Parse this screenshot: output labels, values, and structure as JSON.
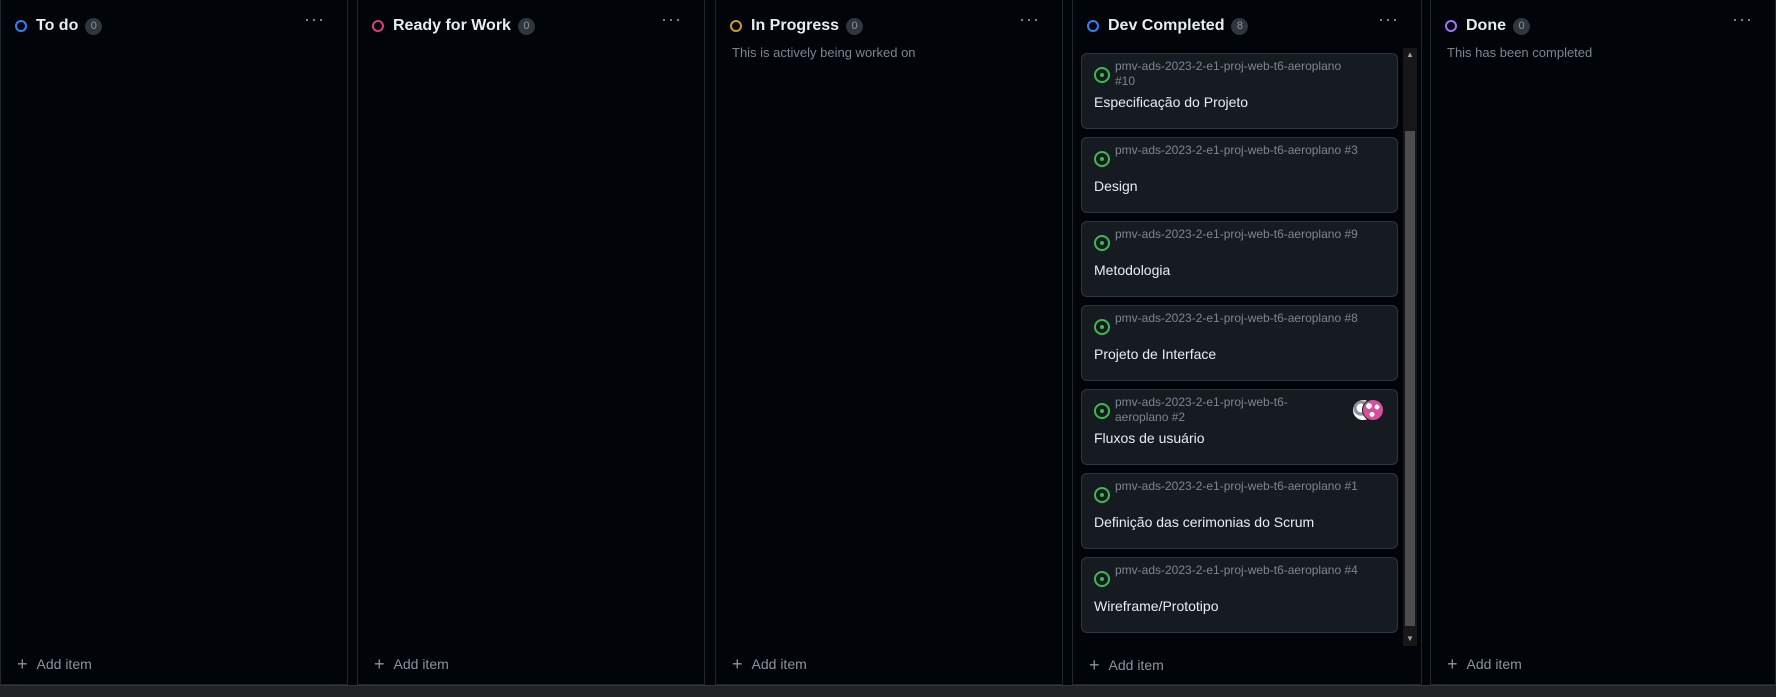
{
  "columns": [
    {
      "title": "To do",
      "count": "0",
      "color": "#2f81f7",
      "description": "",
      "add_label": "Add item"
    },
    {
      "title": "Ready for Work",
      "count": "0",
      "color": "#db3c80",
      "description": "",
      "add_label": "Add item"
    },
    {
      "title": "In Progress",
      "count": "0",
      "color": "#d29922",
      "description": "This is actively being worked on",
      "add_label": "Add item"
    },
    {
      "title": "Dev Completed",
      "count": "8",
      "color": "#2f81f7",
      "description": "",
      "add_label": "Add item"
    },
    {
      "title": "Done",
      "count": "0",
      "color": "#a371f7",
      "description": "This has been completed",
      "add_label": "Add item"
    }
  ],
  "menu_glyph": "···",
  "plus_glyph": "+",
  "cards": [
    {
      "repo": "pmv-ads-2023-2-e1-proj-web-t6-aeroplano #10",
      "title": "Especificação do Projeto"
    },
    {
      "repo": "pmv-ads-2023-2-e1-proj-web-t6-aeroplano #3",
      "title": "Design"
    },
    {
      "repo": "pmv-ads-2023-2-e1-proj-web-t6-aeroplano #9",
      "title": "Metodologia"
    },
    {
      "repo": "pmv-ads-2023-2-e1-proj-web-t6-aeroplano #8",
      "title": "Projeto de Interface"
    },
    {
      "repo": "pmv-ads-2023-2-e1-proj-web-t6-aeroplano #2",
      "title": "Fluxos de usuário",
      "has_avatars": true
    },
    {
      "repo": "pmv-ads-2023-2-e1-proj-web-t6-aeroplano #1",
      "title": "Definição das cerimonias do Scrum"
    },
    {
      "repo": "pmv-ads-2023-2-e1-proj-web-t6-aeroplano #4",
      "title": "Wireframe/Prototipo"
    }
  ],
  "icons": {
    "status": "circle-status-icon",
    "issue": "issue-open-icon",
    "plus": "plus-icon",
    "menu": "kebab-menu-icon"
  }
}
